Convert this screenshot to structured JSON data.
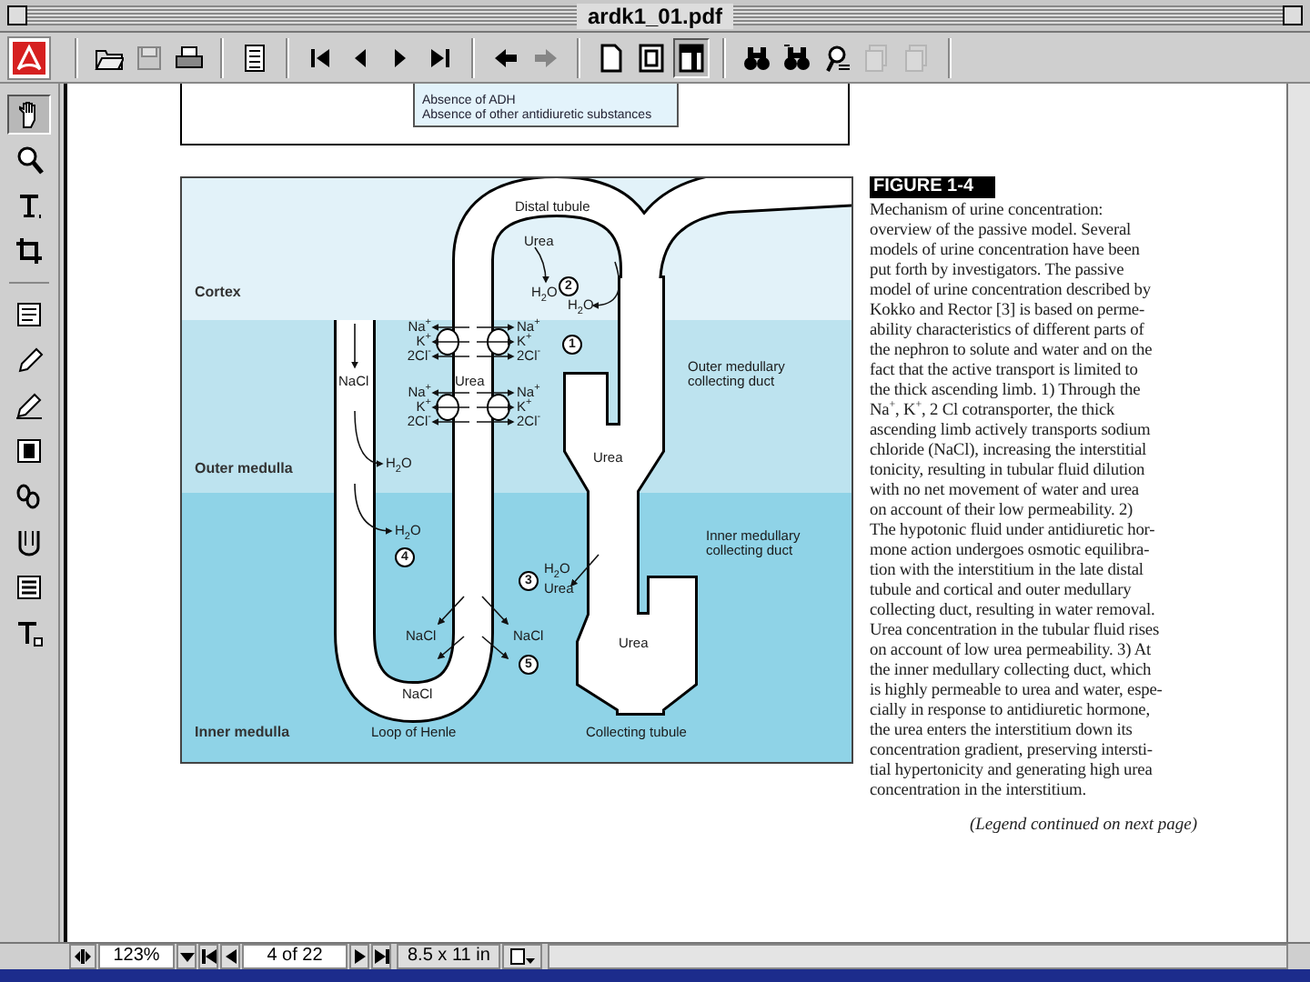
{
  "window": {
    "title": "ardk1_01.pdf"
  },
  "toolbar": {
    "groups": [
      {
        "items": [
          {
            "disabled": false
          },
          {
            "disabled": true
          },
          {
            "disabled": false
          }
        ]
      },
      {
        "items": [
          {
            "disabled": false
          }
        ]
      },
      {
        "items": [
          {
            "disabled": false
          },
          {
            "disabled": false
          },
          {
            "disabled": false
          },
          {
            "disabled": false
          }
        ]
      },
      {
        "items": [
          {
            "disabled": false
          },
          {
            "disabled": true
          }
        ]
      },
      {
        "items": [
          {
            "selected": false
          },
          {
            "selected": false
          },
          {
            "selected": true
          }
        ]
      },
      {
        "items": [
          {
            "disabled": false
          },
          {
            "disabled": false
          },
          {
            "disabled": false
          },
          {
            "disabled": true
          },
          {
            "disabled": true
          }
        ]
      }
    ]
  },
  "tools": [
    {
      "selected": true
    },
    {
      "selected": false
    },
    {
      "selected": false
    },
    {
      "selected": false
    },
    {
      "selected": false
    },
    {
      "selected": false
    },
    {
      "selected": false
    },
    {
      "selected": false
    },
    {
      "selected": false
    },
    {
      "selected": false
    },
    {
      "selected": false
    },
    {
      "selected": false
    }
  ],
  "document": {
    "note_box": {
      "lines": [
        "Absence of ADH",
        "Absence of other antidiuretic substances"
      ]
    },
    "figure": {
      "diagram": {
        "labels": [
          {
            "text": "Distal tubule",
            "kind": "structure"
          },
          {
            "text": "Urea",
            "kind": "solute"
          },
          {
            "text": "H$_{2}$O",
            "kind": "solute"
          },
          {
            "text": "2",
            "kind": "step"
          },
          {
            "text": "H$_{2}$O",
            "kind": "solute"
          },
          {
            "text": "Cortex",
            "kind": "zone"
          },
          {
            "text": "Na$^{+}$",
            "kind": "solute"
          },
          {
            "text": "K$^{+}$",
            "kind": "solute"
          },
          {
            "text": "2Cl$^{-}$",
            "kind": "solute"
          },
          {
            "text": "Na$^{+}$",
            "kind": "solute"
          },
          {
            "text": "K$^{+}$",
            "kind": "solute"
          },
          {
            "text": "2Cl$^{-}$",
            "kind": "solute"
          },
          {
            "text": "1",
            "kind": "step"
          },
          {
            "text": "NaCl",
            "kind": "solute"
          },
          {
            "text": "Urea",
            "kind": "solute"
          },
          {
            "text": "Outer medullary collecting duct",
            "kind": "structure"
          },
          {
            "text": "Na$^{+}$",
            "kind": "solute"
          },
          {
            "text": "K$^{+}$",
            "kind": "solute"
          },
          {
            "text": "2Cl$^{-}$",
            "kind": "solute"
          },
          {
            "text": "Na$^{+}$",
            "kind": "solute"
          },
          {
            "text": "K$^{+}$",
            "kind": "solute"
          },
          {
            "text": "2Cl$^{-}$",
            "kind": "solute"
          },
          {
            "text": "Urea",
            "kind": "solute"
          },
          {
            "text": "H$_{2}$O",
            "kind": "solute"
          },
          {
            "text": "Outer medulla",
            "kind": "zone"
          },
          {
            "text": "H$_{2}$O",
            "kind": "solute"
          },
          {
            "text": "4",
            "kind": "step"
          },
          {
            "text": "3",
            "kind": "step"
          },
          {
            "text": "H$_{2}$O",
            "kind": "solute"
          },
          {
            "text": "Urea",
            "kind": "solute"
          },
          {
            "text": "Inner medullary collecting duct",
            "kind": "structure"
          },
          {
            "text": "NaCl",
            "kind": "solute"
          },
          {
            "text": "NaCl",
            "kind": "solute"
          },
          {
            "text": "5",
            "kind": "step"
          },
          {
            "text": "Urea",
            "kind": "solute"
          },
          {
            "text": "NaCl",
            "kind": "solute"
          },
          {
            "text": "Inner medulla",
            "kind": "zone"
          },
          {
            "text": "Loop of Henle",
            "kind": "structure"
          },
          {
            "text": "Collecting tubule",
            "kind": "structure"
          }
        ]
      },
      "legend": {
        "title": "FIGURE 1-4",
        "lines": [
          "Mechanism of urine concentration:",
          "overview of the passive model. Several",
          "models of urine concentration have been",
          "put forth by investigators. The passive",
          "model of urine concentration described by",
          "Kokko and Rector [3] is based on perme-",
          "ability characteristics of different parts of",
          "the nephron to solute and water and on the",
          "fact that the active transport is limited to",
          "the thick ascending limb. 1) Through the",
          "Na$^{+}$, K$^{+}$, 2 Cl cotransporter, the thick",
          "ascending limb actively transports sodium",
          "chloride (NaCl), increasing the interstitial",
          "tonicity, resulting in tubular fluid dilution",
          "with no net movement of water and urea",
          "on account of their low permeability. 2)",
          "The hypotonic fluid under antidiuretic hor-",
          "mone action undergoes osmotic equilibra-",
          "tion with the interstitium in the late distal",
          "tubule and cortical and outer medullary",
          "collecting duct, resulting in water removal.",
          "Urea concentration in the tubular fluid rises",
          "on account of low urea permeability. 3) At",
          "the inner medullary collecting duct, which",
          "is highly permeable to urea and water, espe-",
          "cially in response to antidiuretic hormone,",
          "the urea enters the interstitium down its",
          "concentration gradient, preserving intersti-",
          "tial hypertonicity and generating high urea",
          "concentration in the interstitium."
        ],
        "continued": "(Legend continued on next page)"
      }
    }
  },
  "status_bar": {
    "zoom": "123%",
    "page": "4 of 22",
    "page_size": "8.5 x 11 in"
  }
}
